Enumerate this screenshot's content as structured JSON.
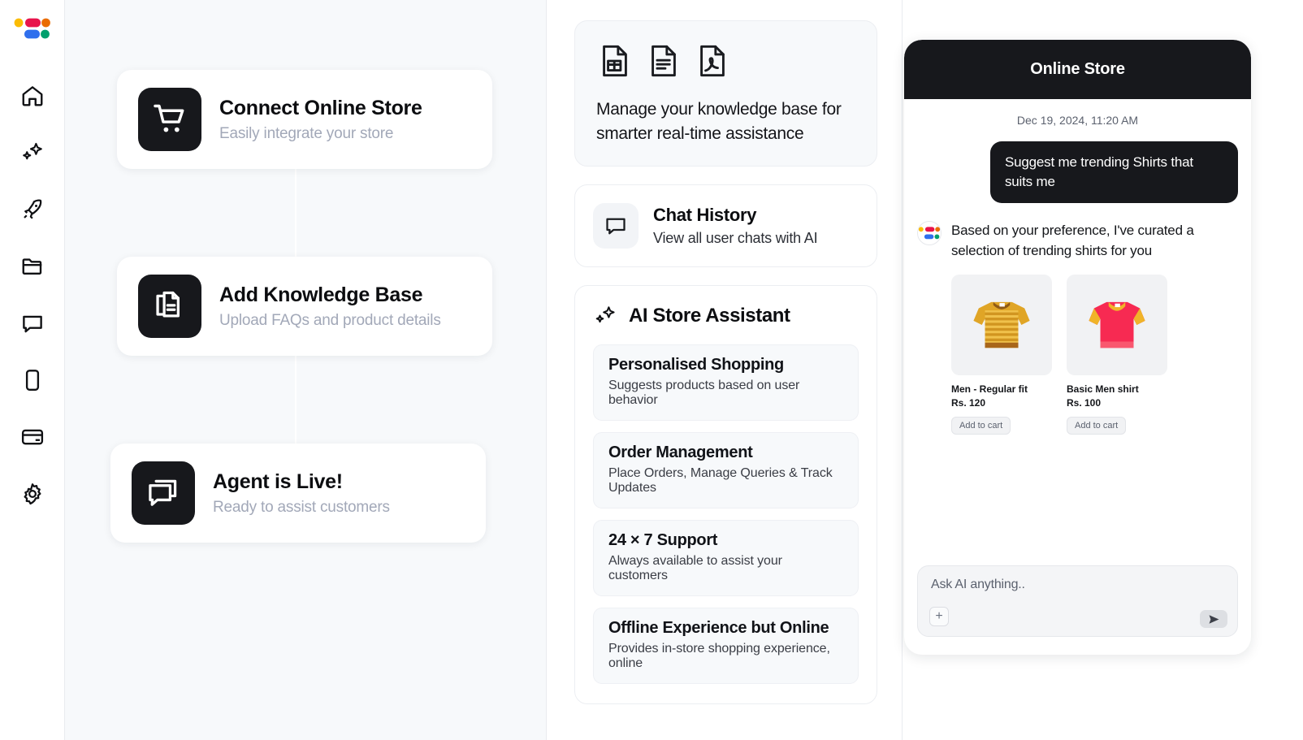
{
  "sidebar": {
    "logo_name": "brand-logo",
    "logo_colors": [
      "#fbbc04",
      "#e8134b",
      "#ea6c00",
      "#2f6fed",
      "#00a06d"
    ],
    "items": [
      {
        "label": "Home",
        "icon": "home-icon"
      },
      {
        "label": "AI",
        "icon": "sparkles-icon"
      },
      {
        "label": "Launch",
        "icon": "rocket-icon"
      },
      {
        "label": "Files",
        "icon": "folder-icon"
      },
      {
        "label": "Chat",
        "icon": "chat-bubble-icon"
      },
      {
        "label": "Mobile",
        "icon": "mobile-icon"
      },
      {
        "label": "Billing",
        "icon": "credit-card-icon"
      },
      {
        "label": "Settings",
        "icon": "gear-icon"
      }
    ]
  },
  "steps": [
    {
      "title": "Connect Online Store",
      "subtitle": "Easily integrate your store",
      "icon": "shopping-cart-icon"
    },
    {
      "title": "Add Knowledge Base",
      "subtitle": "Upload FAQs and product details",
      "icon": "documents-icon"
    },
    {
      "title": "Agent is Live!",
      "subtitle": "Ready to assist customers",
      "icon": "chat-bubbles-icon"
    }
  ],
  "knowledge_base": {
    "text": "Manage your knowledge base for smarter real-time assistance",
    "file_icons": [
      "spreadsheet-file-icon",
      "text-document-file-icon",
      "pdf-file-icon"
    ]
  },
  "chat_history": {
    "title": "Chat History",
    "subtitle": "View all user chats with AI",
    "icon": "chat-bubble-icon"
  },
  "assistant": {
    "title": "AI Store Assistant",
    "icon": "sparkles-icon",
    "features": [
      {
        "title": "Personalised Shopping",
        "subtitle": "Suggests products based on user behavior"
      },
      {
        "title": "Order Management",
        "subtitle": "Place Orders, Manage Queries & Track Updates"
      },
      {
        "title": "24 × 7 Support",
        "subtitle": "Always available to assist your customers"
      },
      {
        "title": "Offline Experience but Online",
        "subtitle": "Provides in-store shopping experience, online"
      }
    ]
  },
  "chat": {
    "header_title": "Online Store",
    "timestamp": "Dec 19, 2024, 11:20 AM",
    "user_message": "Suggest me trending Shirts that suits me",
    "ai_message": "Based on your preference, I've curated a selection of trending shirts for you",
    "products": [
      {
        "name": "Men - Regular fit",
        "price": "Rs. 120",
        "cta": "Add to cart",
        "image": "striped-tshirt-yellow",
        "color": "#e0a526"
      },
      {
        "name": "Basic Men shirt",
        "price": "Rs. 100",
        "cta": "Add to cart",
        "image": "tshirt-pink",
        "color": "#f72a52"
      }
    ],
    "composer": {
      "placeholder": "Ask AI anything..",
      "attach_label": "+",
      "send_label": "send-icon"
    }
  }
}
